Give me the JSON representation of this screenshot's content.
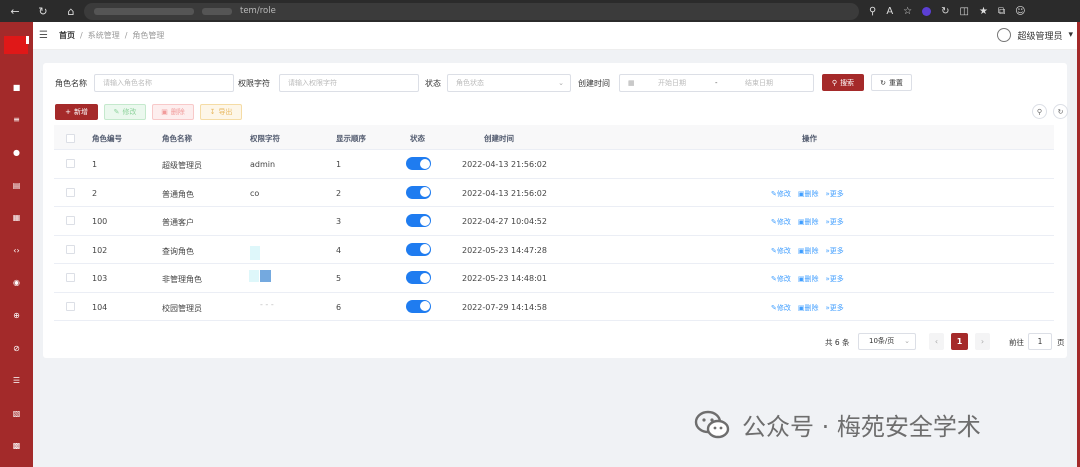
{
  "browser": {
    "url_suffix": "tem/role"
  },
  "header": {
    "breadcrumbs": [
      "首页",
      "系统管理",
      "角色管理"
    ],
    "separator": "/",
    "user_name": "超级管理员"
  },
  "filters": {
    "role_name_label": "角色名称",
    "role_name_placeholder": "请输入角色名称",
    "perm_label": "权限字符",
    "perm_placeholder": "请输入权限字符",
    "status_label": "状态",
    "status_placeholder": "角色状态",
    "created_label": "创建时间",
    "start_placeholder": "开始日期",
    "date_sep": "-",
    "end_placeholder": "结束日期",
    "search_label": "搜索",
    "reset_label": "重置"
  },
  "toolbar": {
    "add_label": "新增",
    "edit_label": "修改",
    "delete_label": "删除",
    "export_label": "导出"
  },
  "table": {
    "columns": [
      "角色编号",
      "角色名称",
      "权限字符",
      "显示顺序",
      "状态",
      "创建时间",
      "操作"
    ],
    "rows": [
      {
        "id": "1",
        "name": "超级管理员",
        "perm": "admin",
        "order": "1",
        "status": true,
        "created": "2022-04-13 21:56:02",
        "ops": false
      },
      {
        "id": "2",
        "name": "普通角色",
        "perm": "co",
        "order": "2",
        "status": true,
        "created": "2022-04-13 21:56:02",
        "ops": true
      },
      {
        "id": "100",
        "name": "普通客户",
        "perm": "",
        "order": "3",
        "status": true,
        "created": "2022-04-27 10:04:52",
        "ops": true
      },
      {
        "id": "102",
        "name": "查询角色",
        "perm": "",
        "order": "4",
        "status": true,
        "created": "2022-05-23 14:47:28",
        "ops": true
      },
      {
        "id": "103",
        "name": "非管理角色",
        "perm": "",
        "order": "5",
        "status": true,
        "created": "2022-05-23 14:48:01",
        "ops": true
      },
      {
        "id": "104",
        "name": "校园管理员",
        "perm": "",
        "order": "6",
        "status": true,
        "created": "2022-07-29 14:14:58",
        "ops": true
      }
    ],
    "op_edit": "修改",
    "op_delete": "删除",
    "op_more": "更多"
  },
  "pagination": {
    "total": "共 6 条",
    "page_size": "10条/页",
    "current_page": "1",
    "goto_label": "前往",
    "goto_value": "1",
    "page_suffix": "页"
  },
  "watermark": {
    "text": "公众号 · 梅苑安全学术"
  },
  "colors": {
    "brand": "#a52a2a",
    "toggle_on": "#1f7cf0",
    "link": "#409eff"
  }
}
